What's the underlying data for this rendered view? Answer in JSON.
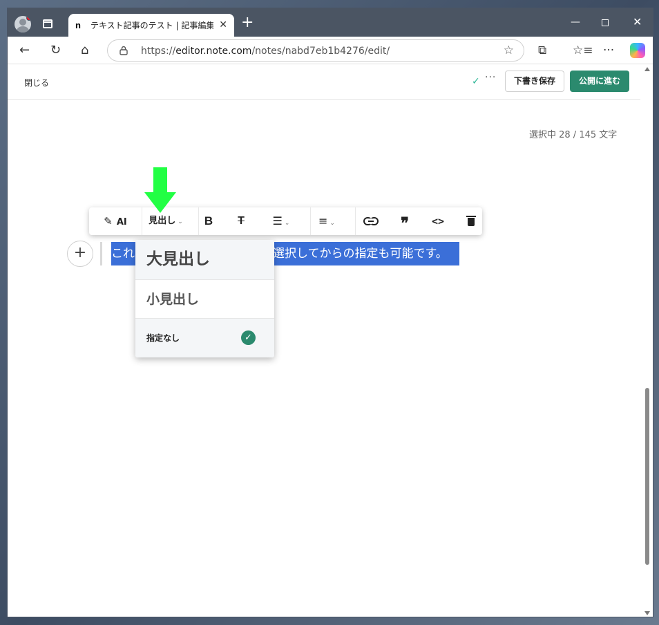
{
  "browser": {
    "tab_title": "テキスト記事のテスト | 記事編集 | note",
    "tab_favicon": "n",
    "tab_close": "✕",
    "new_tab": "+",
    "url_scheme": "https://",
    "url_host": "editor.note.com",
    "url_path": "/notes/nabd7eb1b4276/edit/",
    "icons": {
      "back": "←",
      "reload": "↻",
      "home": "⌂",
      "lock": "🔒",
      "star": "☆",
      "extensions": "⧉",
      "favorites": "☆≡",
      "more": "···",
      "minimize": "—",
      "close": "✕"
    }
  },
  "editor": {
    "close_label": "閉じる",
    "saved_check": "✓",
    "header_more": "···",
    "draft_button": "下書き保存",
    "publish_button": "公開に進む",
    "char_count": "選択中 28 / 145 文字",
    "add_block": "+",
    "text_before": "これ",
    "text_after": "選択してからの指定も可能です。"
  },
  "toolbar": {
    "ai_icon": "✎",
    "ai_label": "AI",
    "heading_label": "見出し",
    "caret": "⌄",
    "bold": "B",
    "strike": "T",
    "list": "☰",
    "align": "≡",
    "link": "⊂⊃",
    "quote": "❞",
    "code": "<>"
  },
  "heading_menu": {
    "items": [
      {
        "label": "大見出し",
        "selected": false
      },
      {
        "label": "小見出し",
        "selected": false
      },
      {
        "label": "指定なし",
        "selected": true
      }
    ],
    "check": "✓"
  },
  "colors": {
    "accent": "#2b8a6e",
    "selection": "#3b6fd8",
    "annotation_arrow": "#22ff44"
  }
}
